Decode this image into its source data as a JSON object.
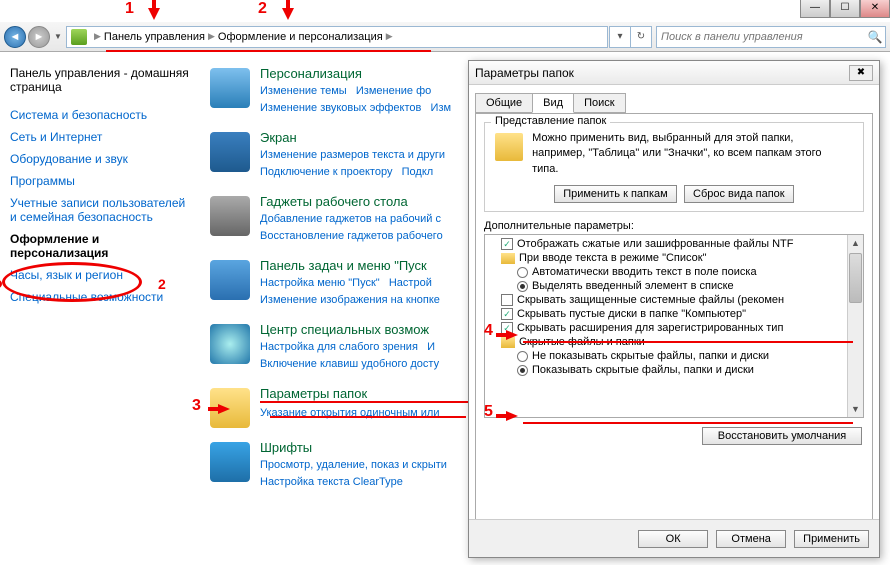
{
  "titlebar": {
    "min": "—",
    "max": "☐",
    "close": "✕"
  },
  "addr": {
    "bc1": "Панель управления",
    "bc2": "Оформление и персонализация",
    "search_ph": "Поиск в панели управления"
  },
  "sidebar": {
    "home": "Панель управления - домашняя страница",
    "items": [
      "Система и безопасность",
      "Сеть и Интернет",
      "Оборудование и звук",
      "Программы",
      "Учетные записи пользователей и семейная безопасность",
      "Оформление и персонализация",
      "Часы, язык и регион",
      "Специальные возможности"
    ]
  },
  "main": {
    "s1": {
      "title": "Персонализация",
      "l1": "Изменение темы",
      "l2": "Изменение фо",
      "l3": "Изменение звуковых эффектов",
      "l4": "Изм"
    },
    "s2": {
      "title": "Экран",
      "l1": "Изменение размеров текста и други",
      "l2": "Подключение к проектору",
      "l3": "Подкл"
    },
    "s3": {
      "title": "Гаджеты рабочего стола",
      "l1": "Добавление гаджетов на рабочий с",
      "l2": "Восстановление гаджетов рабочего"
    },
    "s4": {
      "title": "Панель задач и меню \"Пуск",
      "l1": "Настройка меню \"Пуск\"",
      "l2": "Настрой",
      "l3": "Изменение изображения на кнопке"
    },
    "s5": {
      "title": "Центр специальных возмож",
      "l1": "Настройка для слабого зрения",
      "l2": "И",
      "l3": "Включение клавиш удобного досту"
    },
    "s6": {
      "title": "Параметры папок",
      "l1": "Указание открытия одиночным или"
    },
    "s7": {
      "title": "Шрифты",
      "l1": "Просмотр, удаление, показ и скрыти",
      "l2": "Настройка текста ClearType"
    }
  },
  "dlg": {
    "title": "Параметры папок",
    "tabs": [
      "Общие",
      "Вид",
      "Поиск"
    ],
    "grp_title": "Представление папок",
    "grp_text": "Можно применить вид, выбранный для этой папки, например, \"Таблица\" или \"Значки\", ко всем папкам этого типа.",
    "btn_apply_folders": "Применить к папкам",
    "btn_reset_folders": "Сброс вида папок",
    "adv_label": "Дополнительные параметры:",
    "tree": [
      {
        "type": "chk",
        "checked": true,
        "text": "Отображать сжатые или зашифрованные файлы NTF"
      },
      {
        "type": "fld",
        "text": "При вводе текста в режиме \"Список\""
      },
      {
        "type": "radio",
        "sub": true,
        "checked": false,
        "text": "Автоматически вводить текст в поле поиска"
      },
      {
        "type": "radio",
        "sub": true,
        "checked": true,
        "text": "Выделять введенный элемент в списке"
      },
      {
        "type": "chk",
        "checked": false,
        "text": "Скрывать защищенные системные файлы (рекомен"
      },
      {
        "type": "chk",
        "checked": true,
        "text": "Скрывать пустые диски в папке \"Компьютер\""
      },
      {
        "type": "chk",
        "checked": true,
        "text": "Скрывать расширения для зарегистрированных тип"
      },
      {
        "type": "fld",
        "text": "Скрытые файлы и папки"
      },
      {
        "type": "radio",
        "sub": true,
        "checked": false,
        "text": "Не показывать скрытые файлы, папки и диски"
      },
      {
        "type": "radio",
        "sub": true,
        "checked": true,
        "text": "Показывать скрытые файлы, папки и диски"
      }
    ],
    "btn_restore": "Восстановить умолчания",
    "btn_ok": "ОК",
    "btn_cancel": "Отмена",
    "btn_apply": "Применить"
  },
  "ann": {
    "n1": "1",
    "n2": "2",
    "n3": "3",
    "n4": "4",
    "n5": "5",
    "n2b": "2"
  }
}
